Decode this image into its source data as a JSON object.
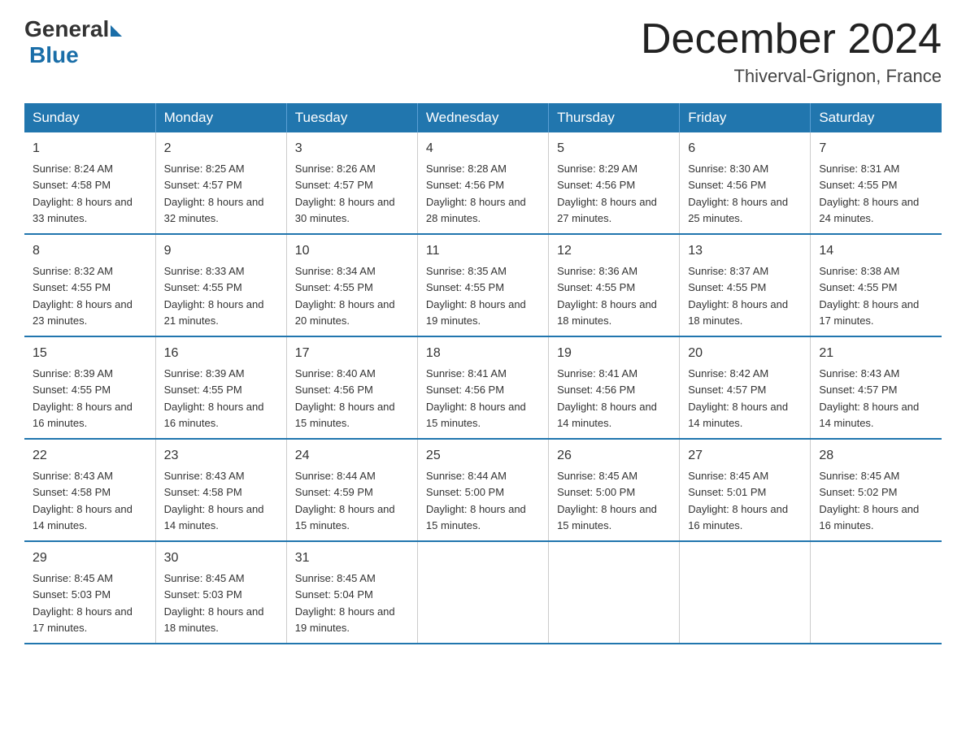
{
  "header": {
    "logo_general": "General",
    "logo_blue": "Blue",
    "month_title": "December 2024",
    "location": "Thiverval-Grignon, France"
  },
  "days_of_week": [
    "Sunday",
    "Monday",
    "Tuesday",
    "Wednesday",
    "Thursday",
    "Friday",
    "Saturday"
  ],
  "weeks": [
    [
      {
        "day": "1",
        "sunrise": "8:24 AM",
        "sunset": "4:58 PM",
        "daylight": "8 hours and 33 minutes."
      },
      {
        "day": "2",
        "sunrise": "8:25 AM",
        "sunset": "4:57 PM",
        "daylight": "8 hours and 32 minutes."
      },
      {
        "day": "3",
        "sunrise": "8:26 AM",
        "sunset": "4:57 PM",
        "daylight": "8 hours and 30 minutes."
      },
      {
        "day": "4",
        "sunrise": "8:28 AM",
        "sunset": "4:56 PM",
        "daylight": "8 hours and 28 minutes."
      },
      {
        "day": "5",
        "sunrise": "8:29 AM",
        "sunset": "4:56 PM",
        "daylight": "8 hours and 27 minutes."
      },
      {
        "day": "6",
        "sunrise": "8:30 AM",
        "sunset": "4:56 PM",
        "daylight": "8 hours and 25 minutes."
      },
      {
        "day": "7",
        "sunrise": "8:31 AM",
        "sunset": "4:55 PM",
        "daylight": "8 hours and 24 minutes."
      }
    ],
    [
      {
        "day": "8",
        "sunrise": "8:32 AM",
        "sunset": "4:55 PM",
        "daylight": "8 hours and 23 minutes."
      },
      {
        "day": "9",
        "sunrise": "8:33 AM",
        "sunset": "4:55 PM",
        "daylight": "8 hours and 21 minutes."
      },
      {
        "day": "10",
        "sunrise": "8:34 AM",
        "sunset": "4:55 PM",
        "daylight": "8 hours and 20 minutes."
      },
      {
        "day": "11",
        "sunrise": "8:35 AM",
        "sunset": "4:55 PM",
        "daylight": "8 hours and 19 minutes."
      },
      {
        "day": "12",
        "sunrise": "8:36 AM",
        "sunset": "4:55 PM",
        "daylight": "8 hours and 18 minutes."
      },
      {
        "day": "13",
        "sunrise": "8:37 AM",
        "sunset": "4:55 PM",
        "daylight": "8 hours and 18 minutes."
      },
      {
        "day": "14",
        "sunrise": "8:38 AM",
        "sunset": "4:55 PM",
        "daylight": "8 hours and 17 minutes."
      }
    ],
    [
      {
        "day": "15",
        "sunrise": "8:39 AM",
        "sunset": "4:55 PM",
        "daylight": "8 hours and 16 minutes."
      },
      {
        "day": "16",
        "sunrise": "8:39 AM",
        "sunset": "4:55 PM",
        "daylight": "8 hours and 16 minutes."
      },
      {
        "day": "17",
        "sunrise": "8:40 AM",
        "sunset": "4:56 PM",
        "daylight": "8 hours and 15 minutes."
      },
      {
        "day": "18",
        "sunrise": "8:41 AM",
        "sunset": "4:56 PM",
        "daylight": "8 hours and 15 minutes."
      },
      {
        "day": "19",
        "sunrise": "8:41 AM",
        "sunset": "4:56 PM",
        "daylight": "8 hours and 14 minutes."
      },
      {
        "day": "20",
        "sunrise": "8:42 AM",
        "sunset": "4:57 PM",
        "daylight": "8 hours and 14 minutes."
      },
      {
        "day": "21",
        "sunrise": "8:43 AM",
        "sunset": "4:57 PM",
        "daylight": "8 hours and 14 minutes."
      }
    ],
    [
      {
        "day": "22",
        "sunrise": "8:43 AM",
        "sunset": "4:58 PM",
        "daylight": "8 hours and 14 minutes."
      },
      {
        "day": "23",
        "sunrise": "8:43 AM",
        "sunset": "4:58 PM",
        "daylight": "8 hours and 14 minutes."
      },
      {
        "day": "24",
        "sunrise": "8:44 AM",
        "sunset": "4:59 PM",
        "daylight": "8 hours and 15 minutes."
      },
      {
        "day": "25",
        "sunrise": "8:44 AM",
        "sunset": "5:00 PM",
        "daylight": "8 hours and 15 minutes."
      },
      {
        "day": "26",
        "sunrise": "8:45 AM",
        "sunset": "5:00 PM",
        "daylight": "8 hours and 15 minutes."
      },
      {
        "day": "27",
        "sunrise": "8:45 AM",
        "sunset": "5:01 PM",
        "daylight": "8 hours and 16 minutes."
      },
      {
        "day": "28",
        "sunrise": "8:45 AM",
        "sunset": "5:02 PM",
        "daylight": "8 hours and 16 minutes."
      }
    ],
    [
      {
        "day": "29",
        "sunrise": "8:45 AM",
        "sunset": "5:03 PM",
        "daylight": "8 hours and 17 minutes."
      },
      {
        "day": "30",
        "sunrise": "8:45 AM",
        "sunset": "5:03 PM",
        "daylight": "8 hours and 18 minutes."
      },
      {
        "day": "31",
        "sunrise": "8:45 AM",
        "sunset": "5:04 PM",
        "daylight": "8 hours and 19 minutes."
      },
      null,
      null,
      null,
      null
    ]
  ],
  "labels": {
    "sunrise": "Sunrise:",
    "sunset": "Sunset:",
    "daylight": "Daylight:"
  }
}
